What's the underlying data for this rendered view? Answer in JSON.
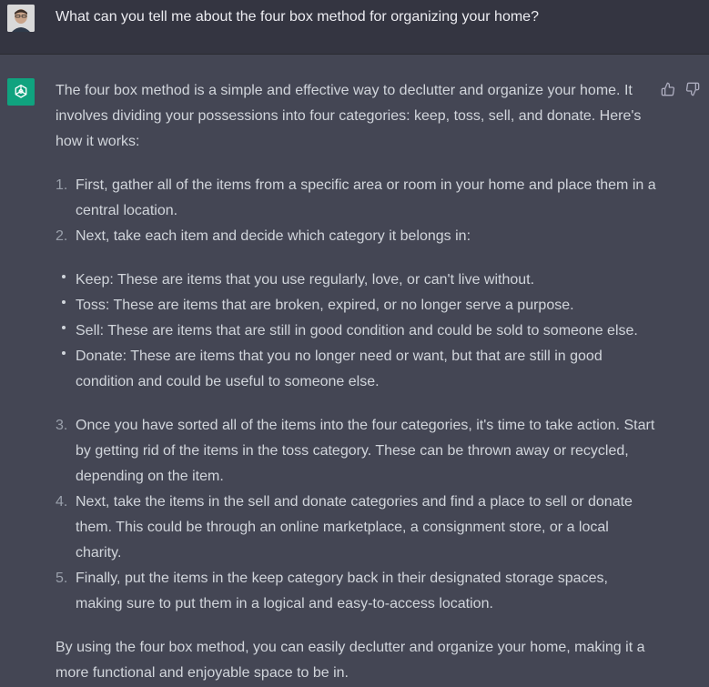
{
  "user_message": {
    "avatar": "user-avatar",
    "text": "What can you tell me about the four box method for organizing your home?"
  },
  "assistant_message": {
    "logo_icon": "openai-logo-icon",
    "brand_color": "#10a37f",
    "feedback": {
      "up_icon": "thumbs-up-icon",
      "down_icon": "thumbs-down-icon"
    },
    "intro": "The four box method is a simple and effective way to declutter and organize your home. It involves dividing your possessions into four categories: keep, toss, sell, and donate. Here's how it works:",
    "steps_a": [
      {
        "num": "1.",
        "text": "First, gather all of the items from a specific area or room in your home and place them in a central location."
      },
      {
        "num": "2.",
        "text": "Next, take each item and decide which category it belongs in:"
      }
    ],
    "categories": [
      "Keep: These are items that you use regularly, love, or can't live without.",
      "Toss: These are items that are broken, expired, or no longer serve a purpose.",
      "Sell: These are items that are still in good condition and could be sold to someone else.",
      "Donate: These are items that you no longer need or want, but that are still in good condition and could be useful to someone else."
    ],
    "steps_b": [
      {
        "num": "3.",
        "text": "Once you have sorted all of the items into the four categories, it's time to take action. Start by getting rid of the items in the toss category. These can be thrown away or recycled, depending on the item."
      },
      {
        "num": "4.",
        "text": "Next, take the items in the sell and donate categories and find a place to sell or donate them. This could be through an online marketplace, a consignment store, or a local charity."
      },
      {
        "num": "5.",
        "text": "Finally, put the items in the keep category back in their designated storage spaces, making sure to put them in a logical and easy-to-access location."
      }
    ],
    "conclusion": "By using the four box method, you can easily declutter and organize your home, making it a more functional and enjoyable space to be in."
  }
}
